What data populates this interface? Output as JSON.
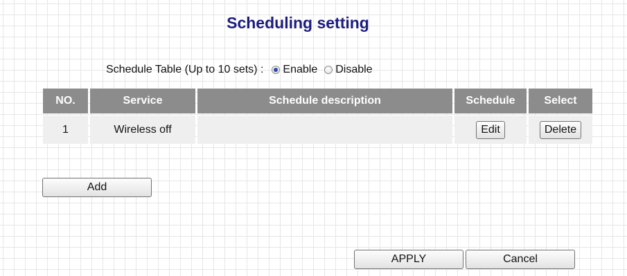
{
  "page": {
    "title": "Scheduling setting"
  },
  "schedule_table_setting": {
    "label": "Schedule Table (Up to 10 sets) :",
    "options": [
      {
        "label": "Enable",
        "selected": true
      },
      {
        "label": "Disable",
        "selected": false
      }
    ]
  },
  "table": {
    "headers": {
      "no": "NO.",
      "service": "Service",
      "description": "Schedule description",
      "schedule": "Schedule",
      "select": "Select"
    },
    "rows": [
      {
        "no": "1",
        "service": "Wireless off",
        "description": "",
        "edit_label": "Edit",
        "delete_label": "Delete"
      }
    ]
  },
  "buttons": {
    "add": "Add",
    "apply": "APPLY",
    "cancel": "Cancel"
  },
  "colors": {
    "title": "#1c1c80",
    "header_bg": "#8c8c8c",
    "header_text": "#ffffff",
    "row_bg": "#efefef",
    "radio_dot": "#2b47a8"
  }
}
